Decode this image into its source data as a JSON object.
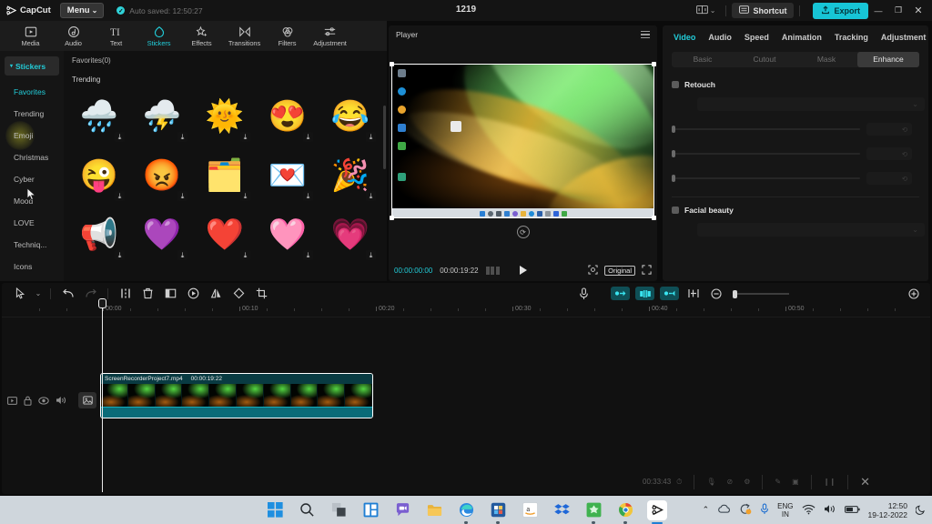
{
  "titlebar": {
    "brand": "CapCut",
    "menu_label": "Menu",
    "menu_caret": "⌄",
    "autosave_text": "Auto saved: 12:50:27",
    "autosave_check": "✓",
    "project_title": "1219",
    "tutorial_icon": "book-icon",
    "tutorial_caret": "⌄",
    "shortcut_label": "Shortcut",
    "shortcut_icon": "keyboard-icon",
    "export_label": "Export",
    "export_icon": "upload-icon",
    "minimize": "—",
    "maximize": "❐",
    "close": "✕",
    "accent": "#17c5d6"
  },
  "tooltabs": [
    {
      "label": "Media",
      "icon": "media-icon",
      "active": false
    },
    {
      "label": "Audio",
      "icon": "audio-icon",
      "active": false
    },
    {
      "label": "Text",
      "icon": "text-icon",
      "active": false
    },
    {
      "label": "Stickers",
      "icon": "stickers-icon",
      "active": true
    },
    {
      "label": "Effects",
      "icon": "effects-icon",
      "active": false
    },
    {
      "label": "Transitions",
      "icon": "transitions-icon",
      "active": false
    },
    {
      "label": "Filters",
      "icon": "filters-icon",
      "active": false
    },
    {
      "label": "Adjustment",
      "icon": "adjustment-icon",
      "active": false
    }
  ],
  "categories": {
    "header": "Stickers",
    "items": [
      {
        "label": "Favorites",
        "state": "selected"
      },
      {
        "label": "Trending",
        "state": "normal"
      },
      {
        "label": "Emoji",
        "state": "hover"
      },
      {
        "label": "Christmas",
        "state": "normal"
      },
      {
        "label": "Cyber",
        "state": "normal"
      },
      {
        "label": "Mood",
        "state": "normal"
      },
      {
        "label": "LOVE",
        "state": "normal"
      },
      {
        "label": "Techniq...",
        "state": "normal"
      },
      {
        "label": "Icons",
        "state": "normal"
      }
    ]
  },
  "stickers": {
    "favorites_label": "Favorites(0)",
    "section_label": "Trending",
    "download_icon": "download-icon",
    "items": [
      {
        "name": "sticker-rain-cloud",
        "glyph": "🌧️"
      },
      {
        "name": "sticker-storm-cloud",
        "glyph": "⛈️"
      },
      {
        "name": "sticker-smiling-sun",
        "glyph": "🌞"
      },
      {
        "name": "sticker-heart-eyes",
        "glyph": "😍"
      },
      {
        "name": "sticker-joy-tears",
        "glyph": "😂"
      },
      {
        "name": "sticker-winking-tongue",
        "glyph": "😜"
      },
      {
        "name": "sticker-angry-flame",
        "glyph": "😡"
      },
      {
        "name": "sticker-hand-window",
        "glyph": "🗂️"
      },
      {
        "name": "sticker-heart-window",
        "glyph": "💌"
      },
      {
        "name": "sticker-party-popper",
        "glyph": "🎉"
      },
      {
        "name": "sticker-megaphone",
        "glyph": "📢"
      },
      {
        "name": "sticker-purple-hearts",
        "glyph": "💜"
      },
      {
        "name": "sticker-red-hearts",
        "glyph": "❤️"
      },
      {
        "name": "sticker-pink-heart",
        "glyph": "🩷"
      },
      {
        "name": "sticker-glow-heart",
        "glyph": "💗"
      }
    ]
  },
  "player": {
    "title": "Player",
    "menu_icon": "hamburger-icon",
    "current_time": "00:00:00:00",
    "total_time": "00:00:19:22",
    "grid_icon": "grid-icon",
    "play_icon": "play-icon",
    "crop_icon": "crop-frame-icon",
    "ratio_label": "Original",
    "fullscreen_icon": "fullscreen-icon",
    "rotate_badge_icon": "rotate-icon"
  },
  "props": {
    "tabs": [
      {
        "label": "Video",
        "active": true
      },
      {
        "label": "Audio",
        "active": false
      },
      {
        "label": "Speed",
        "active": false
      },
      {
        "label": "Animation",
        "active": false
      },
      {
        "label": "Tracking",
        "active": false
      },
      {
        "label": "Adjustment",
        "active": false
      }
    ],
    "subtabs": [
      {
        "label": "Basic",
        "active": false
      },
      {
        "label": "Cutout",
        "active": false
      },
      {
        "label": "Mask",
        "active": false
      },
      {
        "label": "Enhance",
        "active": true
      }
    ],
    "retouch_label": "Retouch",
    "facial_beauty_label": "Facial beauty",
    "dropdown_caret": "⌄",
    "reset_icon": "reset-icon"
  },
  "timeline": {
    "tools_left": [
      {
        "name": "select-tool",
        "icon": "cursor-icon",
        "state": "normal"
      },
      {
        "name": "select-dropdown",
        "icon": "caret-down-icon",
        "state": "normal"
      },
      {
        "name": "undo-button",
        "icon": "undo-icon",
        "state": "normal"
      },
      {
        "name": "redo-button",
        "icon": "redo-icon",
        "state": "disabled"
      },
      {
        "name": "split-button",
        "icon": "split-icon",
        "state": "normal"
      },
      {
        "name": "delete-button",
        "icon": "trash-icon",
        "state": "normal"
      },
      {
        "name": "crop-button",
        "icon": "crop-icon",
        "state": "normal"
      },
      {
        "name": "freeze-button",
        "icon": "freeze-icon",
        "state": "normal"
      },
      {
        "name": "mirror-button",
        "icon": "mirror-icon",
        "state": "normal"
      },
      {
        "name": "rotate-button",
        "icon": "rotate-icon",
        "state": "normal"
      },
      {
        "name": "crop-frame-button",
        "icon": "crop-frame-icon",
        "state": "normal"
      }
    ],
    "tools_right": [
      {
        "name": "record-voiceover-button",
        "icon": "microphone-icon",
        "state": "normal"
      },
      {
        "name": "link-clip-button",
        "icon": "link-left-icon",
        "state": "active"
      },
      {
        "name": "auto-snap-button",
        "icon": "magnet-icon",
        "state": "active"
      },
      {
        "name": "link-audio-button",
        "icon": "link-right-icon",
        "state": "active"
      },
      {
        "name": "cut-marker-button",
        "icon": "scissors-icon",
        "state": "normal"
      },
      {
        "name": "zoom-out-button",
        "icon": "minus-circle-icon",
        "state": "normal"
      },
      {
        "name": "zoom-in-button",
        "icon": "plus-circle-icon",
        "state": "normal"
      }
    ],
    "ruler_labels": [
      "00:00",
      "00:10",
      "00:20",
      "00:30",
      "00:40",
      "00:50"
    ],
    "track_icons": [
      {
        "name": "track-video-icon",
        "icon": "video-icon"
      },
      {
        "name": "track-lock-icon",
        "icon": "lock-icon"
      },
      {
        "name": "track-eye-icon",
        "icon": "eye-icon"
      },
      {
        "name": "track-volume-icon",
        "icon": "volume-icon"
      },
      {
        "name": "track-thumb-icon",
        "icon": "image-icon"
      }
    ],
    "clip": {
      "filename": "ScreenRecorderProject7.mp4",
      "duration": "00:00:19:22"
    }
  },
  "recorder_overlay": {
    "timer": "00:33:43",
    "icons": [
      {
        "name": "stopwatch-icon",
        "glyph": "⏱"
      },
      {
        "name": "microphone-icon",
        "glyph": "🎙"
      },
      {
        "name": "camera-off-icon",
        "glyph": "⊘"
      },
      {
        "name": "settings-icon",
        "glyph": "⚙"
      },
      {
        "name": "pencil-icon",
        "glyph": "✎"
      },
      {
        "name": "screenshot-icon",
        "glyph": "▣"
      },
      {
        "name": "pause-icon",
        "glyph": "❙❙"
      },
      {
        "name": "stop-icon",
        "glyph": "✕"
      }
    ]
  },
  "taskbar": {
    "items": [
      {
        "name": "start-button",
        "label": "Start"
      },
      {
        "name": "search-button",
        "label": "Search"
      },
      {
        "name": "task-view-button",
        "label": "Task View"
      },
      {
        "name": "widgets-button",
        "label": "Widgets"
      },
      {
        "name": "chat-button",
        "label": "Chat"
      },
      {
        "name": "file-explorer-button",
        "label": "File Explorer"
      },
      {
        "name": "edge-button",
        "label": "Microsoft Edge"
      },
      {
        "name": "store-button",
        "label": "Microsoft Store"
      },
      {
        "name": "amazon-button",
        "label": "Amazon"
      },
      {
        "name": "dropbox-button",
        "label": "Dropbox"
      },
      {
        "name": "greenshot-button",
        "label": "Screen Recorder"
      },
      {
        "name": "chrome-button",
        "label": "Google Chrome"
      },
      {
        "name": "capcut-button",
        "label": "CapCut"
      }
    ],
    "tray": {
      "overflow_icon": "chevron-up-icon",
      "onedrive_icon": "cloud-icon",
      "update_icon": "update-icon",
      "mic_icon": "microphone-icon",
      "language_line1": "ENG",
      "language_line2": "IN",
      "wifi_icon": "wifi-icon",
      "volume_icon": "volume-icon",
      "battery_icon": "battery-icon",
      "time": "12:50",
      "date": "19-12-2022",
      "notifications_icon": "moon-icon"
    }
  }
}
